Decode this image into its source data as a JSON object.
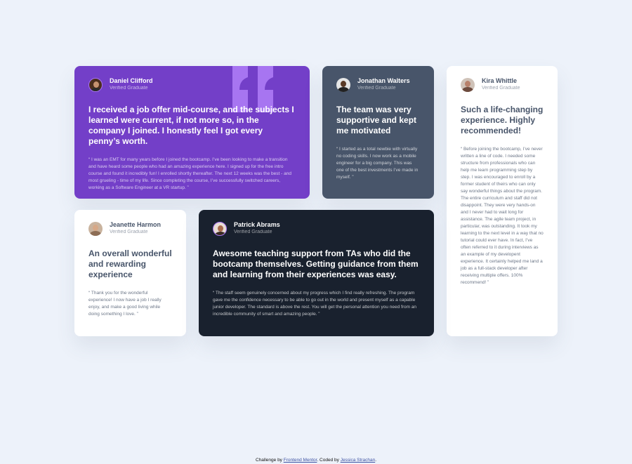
{
  "colors": {
    "background": "#edf2fa",
    "moderate_violet": "#733fc8",
    "very_dark_grayish_blue": "#48556a",
    "very_dark_blackish_blue": "#19212e",
    "white": "#ffffff",
    "link": "#3e52a3"
  },
  "testimonials": [
    {
      "name": "Daniel Clifford",
      "role": "Verified Graduate",
      "avatar_icon": "person-avatar",
      "headline": "I received a job offer mid-course, and the subjects I learned were current, if not more so, in the company I joined. I honestly feel I got every penny’s worth.",
      "quote": "“ I was an EMT for many years before I joined the bootcamp. I’ve been looking to make a transition and have heard some people who had an amazing experience here. I signed up for the free intro course and found it incredibly fun! I enrolled shortly thereafter. The next 12 weeks was the best - and most grueling - time of my life. Since completing the course, I’ve successfully switched careers, working as a Software Engineer at a VR startup. ”"
    },
    {
      "name": "Jonathan Walters",
      "role": "Verified Graduate",
      "avatar_icon": "person-avatar",
      "headline": "The team was very supportive and kept me motivated",
      "quote": "“ I started as a total newbie with virtually no coding skills. I now work as a mobile engineer for a big company. This was one of the best investments I’ve made in myself. ”"
    },
    {
      "name": "Kira Whittle",
      "role": "Verified Graduate",
      "avatar_icon": "person-avatar",
      "headline": "Such a life-changing experience. Highly recommended!",
      "quote": "“ Before joining the bootcamp, I’ve never written a line of code. I needed some structure from professionals who can help me learn programming step by step. I was encouraged to enroll by a former student of theirs who can only say wonderful things about the program. The entire curriculum and staff did not disappoint. They were very hands-on and I never had to wait long for assistance. The agile team project, in particular, was outstanding. It took my learning to the next level in a way that no tutorial could ever have. In fact, I’ve often referred to it during interviews as an example of my developent experience. It certainly helped me land a job as a full-stack developer after receiving multiple offers. 100% recommend! ”"
    },
    {
      "name": "Jeanette Harmon",
      "role": "Verified Graduate",
      "avatar_icon": "person-avatar",
      "headline": "An overall wonderful and rewarding experience",
      "quote": "“ Thank you for the wonderful experience! I now have a job I really enjoy, and make a good living while doing something I love. ”"
    },
    {
      "name": "Patrick Abrams",
      "role": "Verified Graduate",
      "avatar_icon": "person-avatar",
      "headline": "Awesome teaching support from TAs who did the bootcamp themselves. Getting guidance from them and learning from their experiences was easy.",
      "quote": "“ The staff seem genuinely concerned about my progress which I find really refreshing. The program gave me the confidence necessary to be able to go out in the world and present myself as a capable junior developer. The standard is above the rest. You will get the personal attention you need from an incredible community of smart and amazing people. ”"
    }
  ],
  "footer": {
    "prefix": "Challenge by ",
    "challenge_link": "Frontend Mentor",
    "middle": ". Coded by ",
    "author_link": "Jessica Strachan",
    "suffix": "."
  }
}
